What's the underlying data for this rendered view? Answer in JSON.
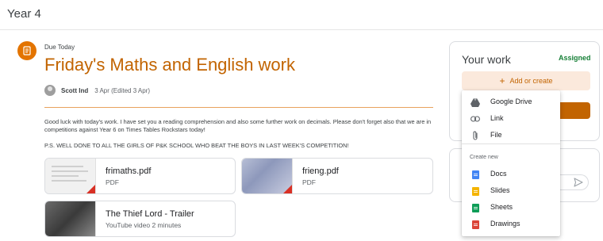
{
  "header": {
    "class_name": "Year 4"
  },
  "assignment": {
    "due": "Due Today",
    "title": "Friday's Maths and English work",
    "author": "Scott Ind",
    "date": "3 Apr (Edited 3 Apr)",
    "body": "Good luck with today's work. I have set you a reading comprehension and also some further work on decimals. Please don't forget also that we are in competitions against Year 6 on Times Tables Rockstars today!",
    "ps": "P.S. WELL DONE TO ALL THE GIRLS OF P&K SCHOOL WHO BEAT THE BOYS IN LAST WEEK'S COMPETITION!",
    "attachments": [
      {
        "name": "frimaths.pdf",
        "sub": "PDF"
      },
      {
        "name": "frieng.pdf",
        "sub": "PDF"
      },
      {
        "name": "The Thief Lord - Trailer",
        "sub": "YouTube video   2 minutes"
      }
    ]
  },
  "your_work": {
    "title": "Your work",
    "status": "Assigned",
    "add_label": "Add or create"
  },
  "menu": {
    "items": [
      {
        "label": "Google Drive",
        "icon": "google-drive-icon"
      },
      {
        "label": "Link",
        "icon": "link-icon"
      },
      {
        "label": "File",
        "icon": "paperclip-icon"
      }
    ],
    "create_heading": "Create new",
    "create_items": [
      {
        "label": "Docs",
        "icon": "docs-icon",
        "color": "#4285f4"
      },
      {
        "label": "Slides",
        "icon": "slides-icon",
        "color": "#f4b400"
      },
      {
        "label": "Sheets",
        "icon": "sheets-icon",
        "color": "#0f9d58"
      },
      {
        "label": "Drawings",
        "icon": "drawings-icon",
        "color": "#db4437"
      }
    ]
  },
  "colors": {
    "accent": "#c26401",
    "assigned": "#188038"
  }
}
